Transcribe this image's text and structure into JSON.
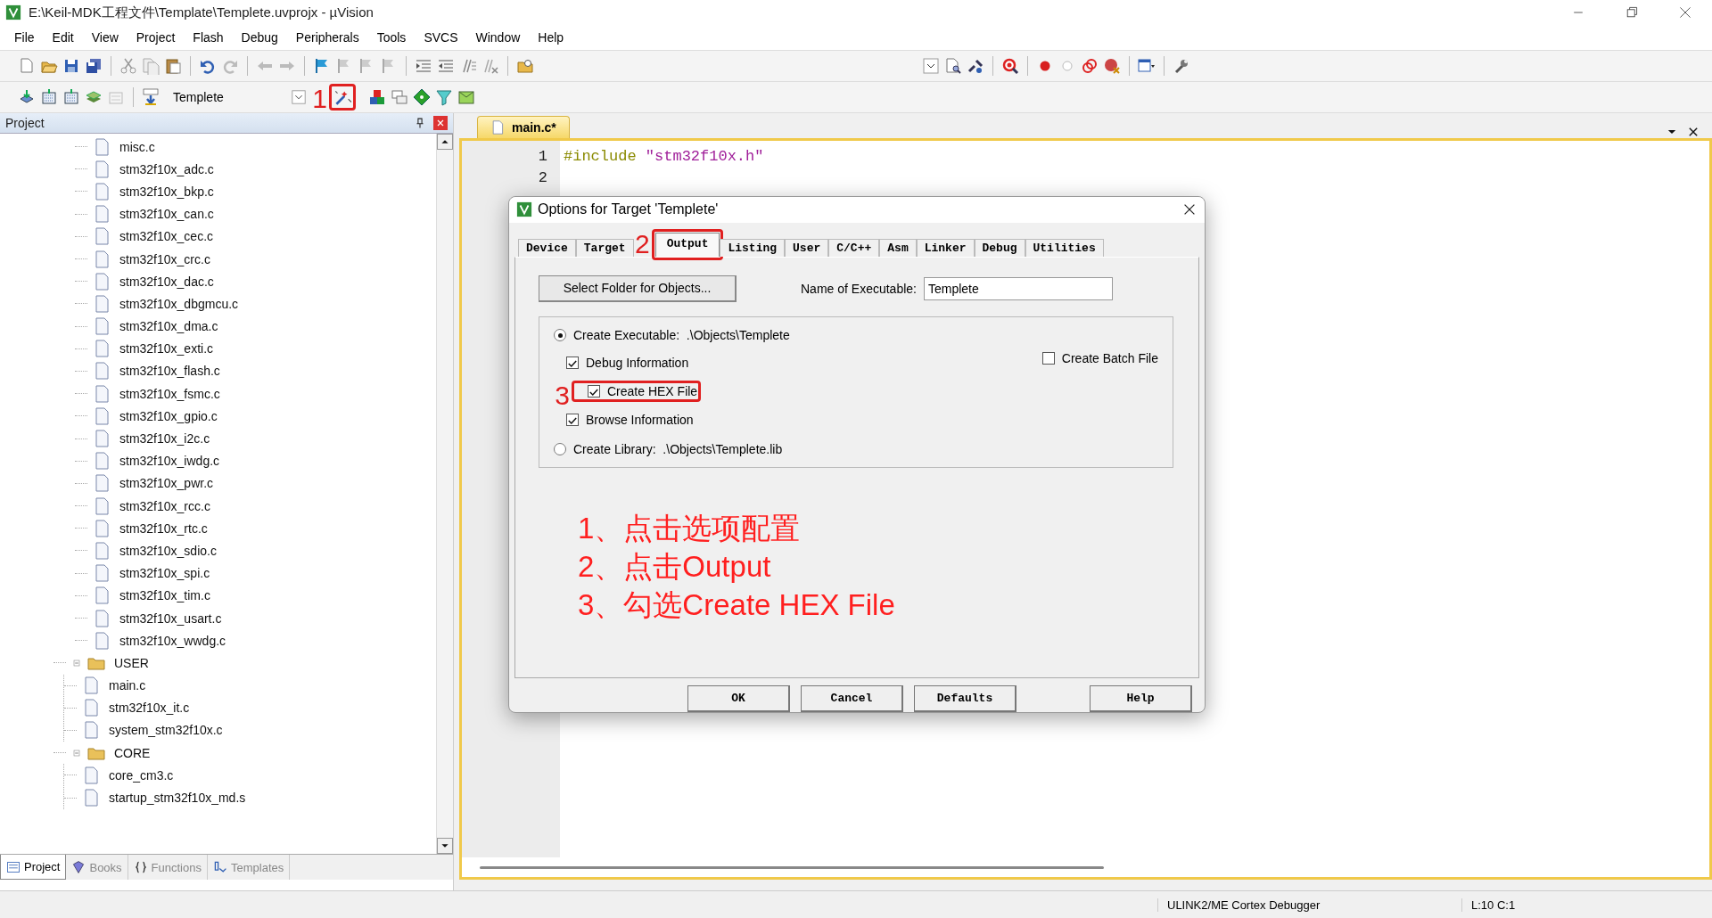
{
  "window": {
    "title": "E:\\Keil-MDK工程文件\\Template\\Templete.uvprojx - µVision"
  },
  "menu": [
    "File",
    "Edit",
    "View",
    "Project",
    "Flash",
    "Debug",
    "Peripherals",
    "Tools",
    "SVCS",
    "Window",
    "Help"
  ],
  "build_toolbar": {
    "target_select": "Templete",
    "options_button": {
      "marker": "1"
    }
  },
  "project_panel": {
    "title": "Project",
    "tree": [
      {
        "children": [
          {
            "kind": "file",
            "label": "misc.c"
          },
          {
            "kind": "file",
            "label": "stm32f10x_adc.c"
          },
          {
            "kind": "file",
            "label": "stm32f10x_bkp.c"
          },
          {
            "kind": "file",
            "label": "stm32f10x_can.c"
          },
          {
            "kind": "file",
            "label": "stm32f10x_cec.c"
          },
          {
            "kind": "file",
            "label": "stm32f10x_crc.c"
          },
          {
            "kind": "file",
            "label": "stm32f10x_dac.c"
          },
          {
            "kind": "file",
            "label": "stm32f10x_dbgmcu.c"
          },
          {
            "kind": "file",
            "label": "stm32f10x_dma.c"
          },
          {
            "kind": "file",
            "label": "stm32f10x_exti.c"
          },
          {
            "kind": "file",
            "label": "stm32f10x_flash.c"
          },
          {
            "kind": "file",
            "label": "stm32f10x_fsmc.c"
          },
          {
            "kind": "file",
            "label": "stm32f10x_gpio.c"
          },
          {
            "kind": "file",
            "label": "stm32f10x_i2c.c"
          },
          {
            "kind": "file",
            "label": "stm32f10x_iwdg.c"
          },
          {
            "kind": "file",
            "label": "stm32f10x_pwr.c"
          },
          {
            "kind": "file",
            "label": "stm32f10x_rcc.c"
          },
          {
            "kind": "file",
            "label": "stm32f10x_rtc.c"
          },
          {
            "kind": "file",
            "label": "stm32f10x_sdio.c"
          },
          {
            "kind": "file",
            "label": "stm32f10x_spi.c"
          },
          {
            "kind": "file",
            "label": "stm32f10x_tim.c"
          },
          {
            "kind": "file",
            "label": "stm32f10x_usart.c"
          },
          {
            "kind": "file",
            "label": "stm32f10x_wwdg.c"
          }
        ]
      },
      {
        "kind": "folder",
        "label": "USER",
        "expanded": true,
        "children": [
          {
            "kind": "file",
            "label": "main.c"
          },
          {
            "kind": "file",
            "label": "stm32f10x_it.c"
          },
          {
            "kind": "file",
            "label": "system_stm32f10x.c"
          }
        ]
      },
      {
        "kind": "folder",
        "label": "CORE",
        "expanded": true,
        "children": [
          {
            "kind": "file",
            "label": "core_cm3.c"
          },
          {
            "kind": "file",
            "label": "startup_stm32f10x_md.s"
          }
        ]
      }
    ],
    "tabs": [
      {
        "label": "Project",
        "selected": true
      },
      {
        "label": "Books",
        "selected": false
      },
      {
        "label": "Functions",
        "selected": false
      },
      {
        "label": "Templates",
        "selected": false
      }
    ]
  },
  "editor": {
    "tab": "main.c*",
    "lines": [
      {
        "number": "1",
        "tokens": [
          {
            "kind": "directive",
            "text": "#include "
          },
          {
            "kind": "string",
            "text": "\"stm32f10x.h\""
          }
        ]
      },
      {
        "number": "2"
      }
    ]
  },
  "dialog": {
    "title": "Options for Target 'Templete'",
    "tabs": [
      {
        "label": "Device",
        "selected": false
      },
      {
        "label": "Target",
        "selected": false
      },
      {
        "label": "Output",
        "selected": true,
        "marker": "2"
      },
      {
        "label": "Listing",
        "selected": false
      },
      {
        "label": "User",
        "selected": false
      },
      {
        "label": "C/C++",
        "selected": false
      },
      {
        "label": "Asm",
        "selected": false
      },
      {
        "label": "Linker",
        "selected": false
      },
      {
        "label": "Debug",
        "selected": false
      },
      {
        "label": "Utilities",
        "selected": false
      }
    ],
    "select_folder_button": "Select Folder for Objects...",
    "executable_name": {
      "label": "Name of Executable:",
      "value": "Templete"
    },
    "output_options": [
      {
        "kind": "radio",
        "label": "Create Executable:  .\\Objects\\Templete",
        "selected": true
      },
      {
        "kind": "checkbox",
        "label": "Debug Information",
        "checked": true
      },
      {
        "kind": "checkbox",
        "label": "Create HEX File",
        "checked": true,
        "marker": "3"
      },
      {
        "kind": "checkbox",
        "label": "Browse Information",
        "checked": true
      },
      {
        "kind": "radio",
        "label": "Create Library:  .\\Objects\\Templete.lib",
        "selected": false
      }
    ],
    "batch_file": {
      "label": "Create Batch File",
      "checked": false
    },
    "notes": [
      "1、点击选项配置",
      "2、点击Output",
      "3、勾选Create HEX File"
    ],
    "buttons": [
      "OK",
      "Cancel",
      "Defaults",
      "Help"
    ]
  },
  "status_bar": {
    "debugger": "ULINK2/ME Cortex Debugger",
    "position": "L:10 C:1"
  }
}
